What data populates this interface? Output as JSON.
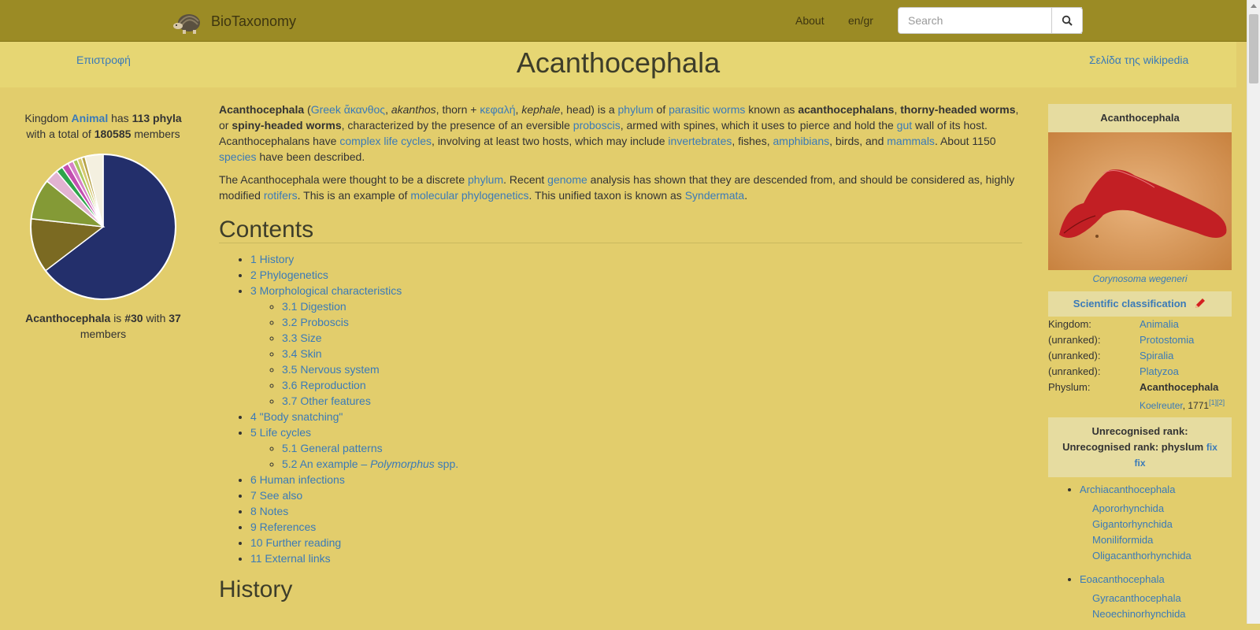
{
  "nav": {
    "brand": "BioTaxonomy",
    "about": "About",
    "lang": "en/gr"
  },
  "search": {
    "placeholder": "Search"
  },
  "icons": {
    "logo": "armadillo-logo-icon",
    "search": "search-icon",
    "edit": "pencil-icon"
  },
  "header": {
    "back": "Επιστροφή",
    "title": "Acanthocephala",
    "wiki": "Σελίδα της wikipedia"
  },
  "sidebar": {
    "kingdom_prefix": "Kingdom",
    "kingdom": "Animal",
    "has": "has",
    "phyla": "113 phyla",
    "with_total": "with a total of",
    "total": "180585",
    "members": "members",
    "rank_name": "Acanthocephala",
    "is": "is",
    "rank": "#30",
    "with": "with",
    "count": "37",
    "members2": "members"
  },
  "pie": {
    "slices": [
      {
        "value": 0.64,
        "color": "#232f6b"
      },
      {
        "value": 0.12,
        "color": "#7b6a22"
      },
      {
        "value": 0.09,
        "color": "#849a36"
      },
      {
        "value": 0.03,
        "color": "#e2b3d1"
      },
      {
        "value": 0.015,
        "color": "#2ea44a"
      },
      {
        "value": 0.015,
        "color": "#c34fb0"
      },
      {
        "value": 0.012,
        "color": "#d681c8"
      },
      {
        "value": 0.01,
        "color": "#a9c860"
      },
      {
        "value": 0.01,
        "color": "#d6c96e"
      },
      {
        "value": 0.008,
        "color": "#b7a348"
      },
      {
        "value": 0.04,
        "color": "#f4f0e0"
      }
    ]
  },
  "article": {
    "p1": [
      {
        "t": "Acanthocephala",
        "s": "b"
      },
      {
        "t": " ("
      },
      {
        "t": "Greek",
        "s": "a"
      },
      {
        "t": " "
      },
      {
        "t": "ἄκανθος",
        "s": "a"
      },
      {
        "t": ", "
      },
      {
        "t": "akanthos",
        "s": "i"
      },
      {
        "t": ", thorn + "
      },
      {
        "t": "κεφαλή",
        "s": "a"
      },
      {
        "t": ", "
      },
      {
        "t": "kephale",
        "s": "i"
      },
      {
        "t": ", head) is a "
      },
      {
        "t": "phylum",
        "s": "a"
      },
      {
        "t": " of "
      },
      {
        "t": "parasitic worms",
        "s": "a"
      },
      {
        "t": " known as "
      },
      {
        "t": "acanthocephalans",
        "s": "b"
      },
      {
        "t": ", "
      },
      {
        "t": "thorny-headed worms",
        "s": "b"
      },
      {
        "t": ", or "
      },
      {
        "t": "spiny-headed worms",
        "s": "b"
      },
      {
        "t": ", characterized by the presence of an eversible "
      },
      {
        "t": "proboscis",
        "s": "a"
      },
      {
        "t": ", armed with spines, which it uses to pierce and hold the "
      },
      {
        "t": "gut",
        "s": "a"
      },
      {
        "t": " wall of its host. Acanthocephalans have "
      },
      {
        "t": "complex life cycles",
        "s": "a"
      },
      {
        "t": ", involving at least two hosts, which may include "
      },
      {
        "t": "invertebrates",
        "s": "a"
      },
      {
        "t": ", fishes, "
      },
      {
        "t": "amphibians",
        "s": "a"
      },
      {
        "t": ", birds, and "
      },
      {
        "t": "mammals",
        "s": "a"
      },
      {
        "t": ". About 1150 "
      },
      {
        "t": "species",
        "s": "a"
      },
      {
        "t": " have been described."
      }
    ],
    "p2": [
      {
        "t": "The Acanthocephala were thought to be a discrete "
      },
      {
        "t": "phylum",
        "s": "a"
      },
      {
        "t": ". Recent "
      },
      {
        "t": "genome",
        "s": "a"
      },
      {
        "t": " analysis has shown that they are descended from, and should be considered as, highly modified "
      },
      {
        "t": "rotifers",
        "s": "a"
      },
      {
        "t": ". This is an example of "
      },
      {
        "t": "molecular phylogenetics",
        "s": "a"
      },
      {
        "t": ". This unified taxon is known as "
      },
      {
        "t": "Syndermata",
        "s": "a"
      },
      {
        "t": "."
      }
    ],
    "contents_heading": "Contents",
    "toc": [
      {
        "label": "1 History"
      },
      {
        "label": "2 Phylogenetics"
      },
      {
        "label": "3 Morphological characteristics",
        "children": [
          {
            "label": "3.1 Digestion"
          },
          {
            "label": "3.2 Proboscis"
          },
          {
            "label": "3.3 Size"
          },
          {
            "label": "3.4 Skin"
          },
          {
            "label": "3.5 Nervous system"
          },
          {
            "label": "3.6 Reproduction"
          },
          {
            "label": "3.7 Other features"
          }
        ]
      },
      {
        "label": "4 \"Body snatching\""
      },
      {
        "label": "5 Life cycles",
        "children": [
          {
            "label": "5.1 General patterns"
          },
          {
            "label": "5.2 An example – ",
            "italic": "Polymorphus",
            "suffix": " spp."
          }
        ]
      },
      {
        "label": "6 Human infections"
      },
      {
        "label": "7 See also"
      },
      {
        "label": "8 Notes"
      },
      {
        "label": "9 References"
      },
      {
        "label": "10 Further reading"
      },
      {
        "label": "11 External links"
      }
    ],
    "history_heading": "History"
  },
  "infobox": {
    "title": "Acanthocephala",
    "caption": "Corynosoma wegeneri",
    "sci_class": "Scientific classification",
    "rows": [
      {
        "k": "Kingdom:",
        "v": "Animalia",
        "link": true
      },
      {
        "k": "(unranked):",
        "v": "Protostomia",
        "link": true
      },
      {
        "k": "(unranked):",
        "v": "Spiralia",
        "link": true
      },
      {
        "k": "(unranked):",
        "v": "Platyzoa",
        "link": true
      },
      {
        "k": "Physlum:",
        "v": "Acanthocephala",
        "link": false
      }
    ],
    "author": "Koelreuter",
    "author_year": ", 1771",
    "author_refs": "[1][2]",
    "unrec_line1": "Unrecognised rank:",
    "unrec_line2": "Unrecognised rank: physlum",
    "fix": "fix",
    "groups": [
      {
        "name": "Archiacanthocephala",
        "items": [
          "Apororhynchida",
          "Gigantorhynchida",
          "Moniliformida",
          "Oligacanthorhynchida"
        ]
      },
      {
        "name": "Eoacanthocephala",
        "items": [
          "Gyracanthocephala",
          "Neoechinorhynchida"
        ]
      }
    ]
  },
  "colors": {
    "background": "#e2cd6c",
    "navbar": "#9b8b25",
    "link": "#3a7ab8",
    "infobox_header": "#e6dca0"
  }
}
